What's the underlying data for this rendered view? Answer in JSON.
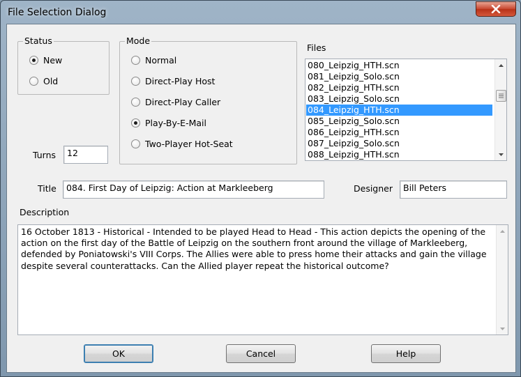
{
  "window": {
    "title": "File Selection Dialog"
  },
  "status": {
    "label": "Status",
    "options": [
      {
        "label": "New",
        "checked": true
      },
      {
        "label": "Old",
        "checked": false
      }
    ]
  },
  "mode": {
    "label": "Mode",
    "options": [
      {
        "label": "Normal",
        "checked": false
      },
      {
        "label": "Direct-Play Host",
        "checked": false
      },
      {
        "label": "Direct-Play Caller",
        "checked": false
      },
      {
        "label": "Play-By-E-Mail",
        "checked": true
      },
      {
        "label": "Two-Player Hot-Seat",
        "checked": false
      }
    ]
  },
  "files": {
    "label": "Files",
    "items": [
      "080_Leipzig_HTH.scn",
      "081_Leipzig_Solo.scn",
      "082_Leipzig_HTH.scn",
      "083_Leipzig_Solo.scn",
      "084_Leipzig_HTH.scn",
      "085_Leipzig_Solo.scn",
      "086_Leipzig_HTH.scn",
      "087_Leipzig_Solo.scn",
      "088_Leipzig_HTH.scn"
    ],
    "selected_item": "084_Leipzig_HTH.scn"
  },
  "turns": {
    "label": "Turns",
    "value": "12"
  },
  "title_field": {
    "label": "Title",
    "value": "084. First Day of Leipzig: Action at Markleeberg"
  },
  "designer": {
    "label": "Designer",
    "value": "Bill Peters"
  },
  "description": {
    "label": "Description",
    "text": "16 October 1813 - Historical - Intended to be played Head to Head - This action depicts the opening of the action on the first day of the Battle of Leipzig on the southern front around the village of Markleeberg, defended by Poniatowski's VIII Corps. The Allies were able to press home their attacks and gain the village despite several counterattacks. Can the Allied player repeat the historical outcome?"
  },
  "buttons": {
    "ok": "OK",
    "cancel": "Cancel",
    "help": "Help"
  },
  "icons": {
    "close": "close-icon",
    "radio": "radio-button-icon",
    "scroll_up": "scroll-up-arrow-icon",
    "scroll_down": "scroll-down-arrow-icon",
    "scroll_thumb": "scroll-thumb-grip-icon"
  },
  "colors": {
    "selection": "#3399ff",
    "close_button": "#c94a33",
    "dialog_face": "#f0f0f0"
  }
}
